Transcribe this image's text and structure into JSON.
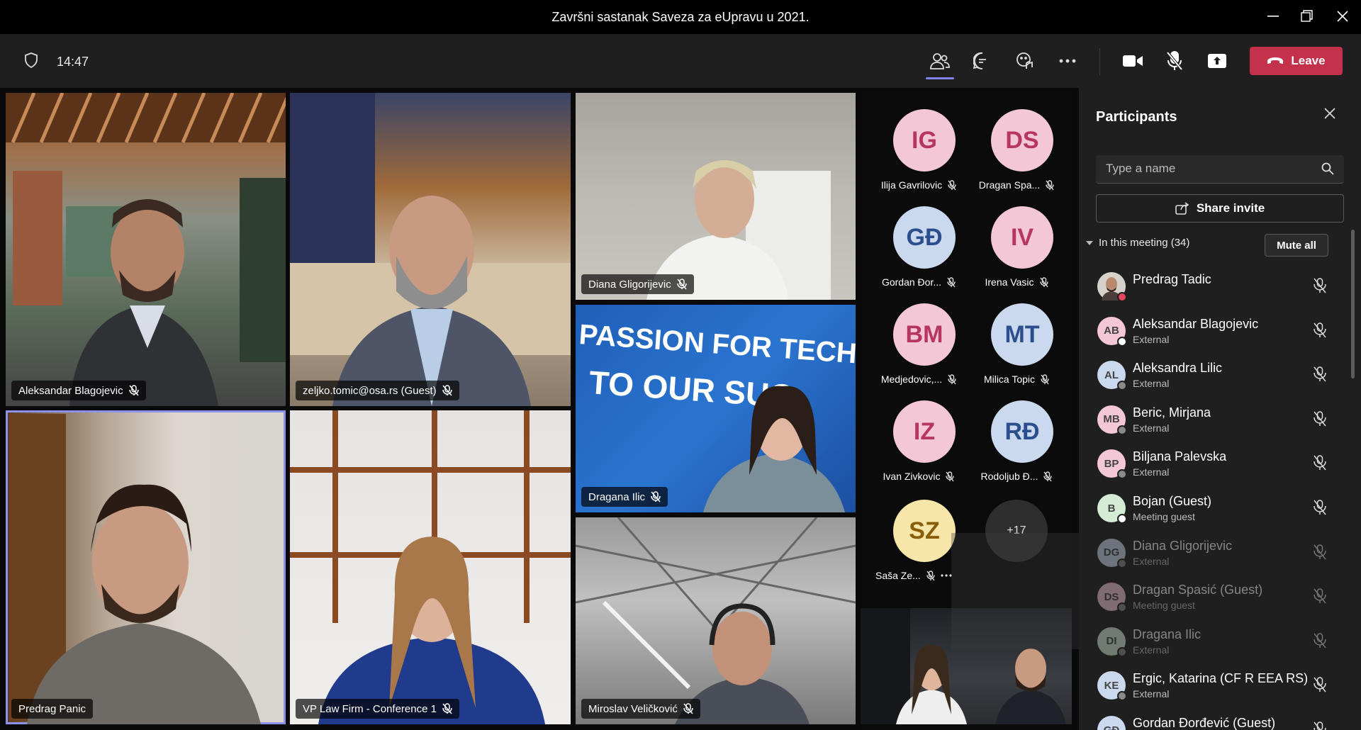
{
  "window": {
    "title": "Završni sastanak Saveza za eUpravu u 2021."
  },
  "toolbar": {
    "time": "14:47",
    "leave_label": "Leave"
  },
  "tiles": [
    {
      "name": "Aleksandar Blagojevic"
    },
    {
      "name": "zeljko.tomic@osa.rs (Guest)"
    },
    {
      "name": "Diana Gligorijevic"
    },
    {
      "name": "Dragana Ilic"
    },
    {
      "name": "Predrag Panic"
    },
    {
      "name": "VP Law Firm - Conference 1"
    },
    {
      "name": "Miroslav Veličković"
    }
  ],
  "tile_graphics": {
    "banner_line1": "PASSION FOR TECHN",
    "banner_line2": "TO OUR SUC"
  },
  "roster": [
    {
      "initials": "IG",
      "name": "Ilija Gavrilovic",
      "color": "#f3c7d6"
    },
    {
      "initials": "DS",
      "name": "Dragan Spa...",
      "color": "#f3c7d6"
    },
    {
      "initials": "GĐ",
      "name": "Gordan Đor...",
      "color": "#cbd9ef"
    },
    {
      "initials": "IV",
      "name": "Irena Vasic",
      "color": "#f3c7d6"
    },
    {
      "initials": "BM",
      "name": "Medjedovic,...",
      "color": "#f3c7d6"
    },
    {
      "initials": "MT",
      "name": "Milica Topic",
      "color": "#cbd9ef"
    },
    {
      "initials": "IZ",
      "name": "Ivan Zivkovic",
      "color": "#f3c7d6"
    },
    {
      "initials": "RĐ",
      "name": "Rodoljub Đ...",
      "color": "#cbd9ef"
    },
    {
      "initials": "SZ",
      "name": "Saša Ze...",
      "color": "#f7e6a9"
    }
  ],
  "roster_more": "+17",
  "panel": {
    "title": "Participants",
    "search_placeholder": "Type a name",
    "share_label": "Share invite",
    "in_meeting": "In this meeting (34)",
    "mute_all": "Mute all",
    "participants": [
      {
        "initials": "",
        "name": "Predrag Tadic",
        "sub": "",
        "color": "#6b5a4e",
        "dot": "#e3455e"
      },
      {
        "initials": "AB",
        "name": "Aleksandar Blagojevic",
        "sub": "External",
        "color": "#f3c7d6",
        "dot": "#ffffff"
      },
      {
        "initials": "AL",
        "name": "Aleksandra Lilic",
        "sub": "External",
        "color": "#cbd9ef",
        "dot": "#8a8a8a"
      },
      {
        "initials": "MB",
        "name": "Beric, Mirjana",
        "sub": "External",
        "color": "#f3c7d6",
        "dot": "#8a8a8a"
      },
      {
        "initials": "BP",
        "name": "Biljana Palevska",
        "sub": "External",
        "color": "#f3c7d6",
        "dot": "#8a8a8a"
      },
      {
        "initials": "B",
        "name": "Bojan (Guest)",
        "sub": "Meeting guest",
        "color": "#d5ecd4",
        "dot": "#ffffff"
      },
      {
        "initials": "DG",
        "name": "Diana Gligorijevic",
        "sub": "External",
        "color": "#cbd9ef",
        "dot": "#8a8a8a"
      },
      {
        "initials": "DS",
        "name": "Dragan Spasić (Guest)",
        "sub": "Meeting guest",
        "color": "#f3c7d6",
        "dot": "#8a8a8a"
      },
      {
        "initials": "DI",
        "name": "Dragana Ilic",
        "sub": "External",
        "color": "#d5ecd4",
        "dot": "#8a8a8a"
      },
      {
        "initials": "KE",
        "name": "Ergic, Katarina (CF R EEA RS)",
        "sub": "External",
        "color": "#cbd9ef",
        "dot": "#8a8a8a"
      },
      {
        "initials": "GĐ",
        "name": "Gordan Đorđević (Guest)",
        "sub": "",
        "color": "#cbd9ef",
        "dot": "#8a8a8a"
      }
    ]
  },
  "colors": {
    "leave": "#c4314b",
    "accent": "#7f85f5",
    "panel_bg": "#1f1f1f"
  }
}
